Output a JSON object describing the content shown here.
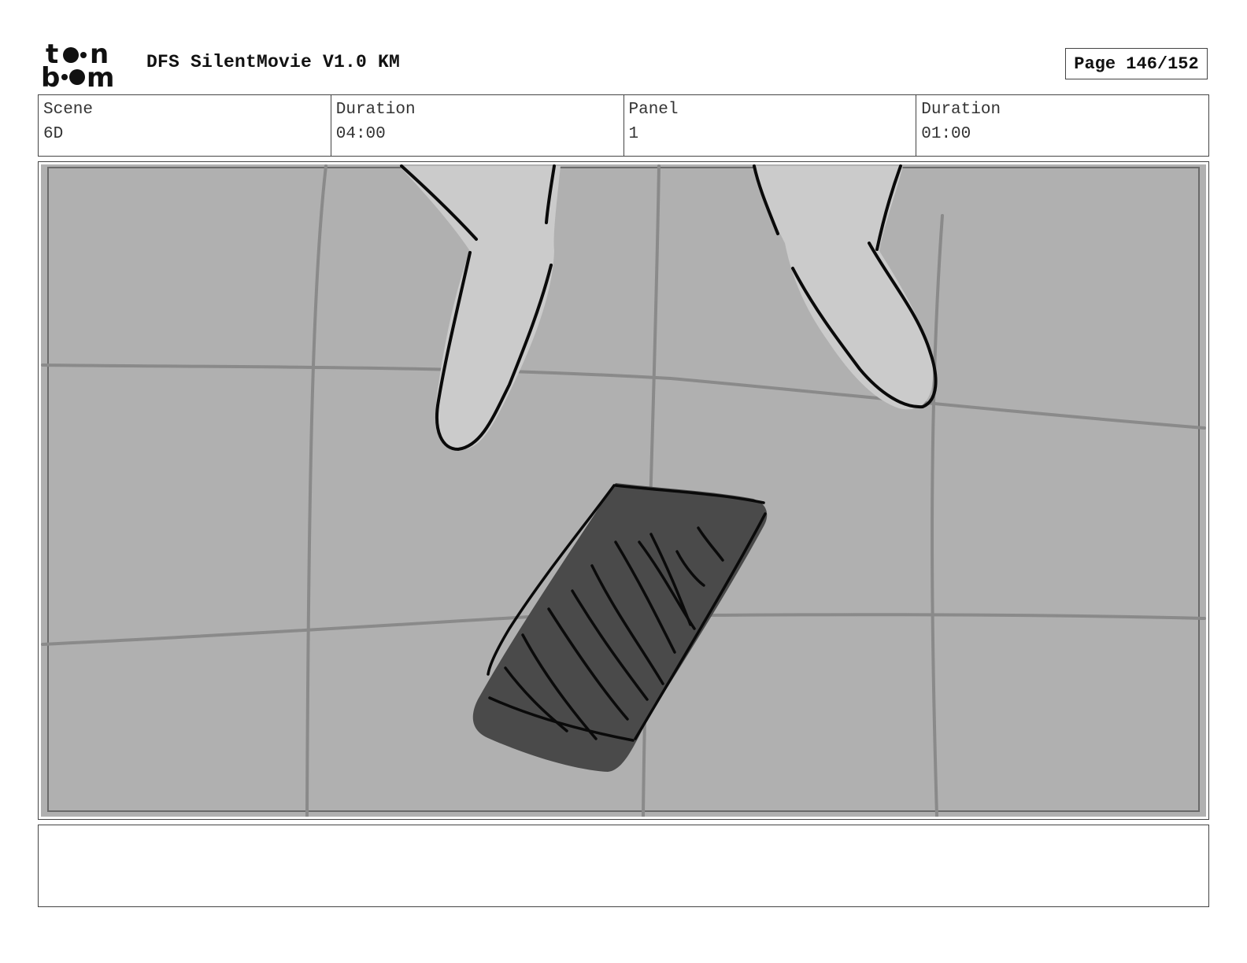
{
  "header": {
    "logo_text": "toon boom",
    "document_title": "DFS SilentMovie V1.0 KM",
    "page_label": "Page 146/152"
  },
  "info": {
    "scene_label": "Scene",
    "scene_value": "6D",
    "scene_duration_label": "Duration",
    "scene_duration_value": "04:00",
    "panel_label": "Panel",
    "panel_value": "1",
    "panel_duration_label": "Duration",
    "panel_duration_value": "01:00"
  },
  "panel_image": {
    "description_icon": "storyboard-sketch-fingers-and-phone-on-tiled-floor",
    "colors": {
      "background": "#b0b0b0",
      "grid_lines": "#8a8a8a",
      "fingers": "#cbcbcb",
      "phone": "#4a4a4a",
      "ink": "#0a0a0a"
    }
  },
  "notes": {
    "text": ""
  }
}
